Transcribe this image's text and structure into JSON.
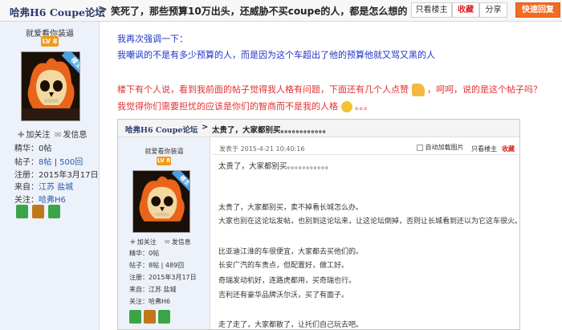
{
  "header": {
    "forum": "哈弗H6 Coupe论坛",
    "arrow": ">",
    "thread_title": "笑死了，那些预算10万出头，还威胁不买coupe的人，都是怎么想的",
    "btn_only_op": "只看楼主",
    "btn_fav": "收藏",
    "btn_share": "分享",
    "btn_reply": "快速回复"
  },
  "sidebar": {
    "username": "就爱看你装逼",
    "level": "LV 8",
    "ribbon": "楼主",
    "follow": "加关注",
    "message": "发信息",
    "jinghua_label": "精华：",
    "jinghua_value": "0帖",
    "posts_label": "帖子：",
    "posts_value": "8帖",
    "posts_sep": "|",
    "replies_value": "500回",
    "reg_label": "注册：",
    "reg_value": "2015年3月17日",
    "from_label": "来自：",
    "from_value": "江苏  盐城",
    "follow_label": "关注：",
    "follow_value": "哈弗H6"
  },
  "post": {
    "line0": "我再次强调一下：",
    "line1": "我嘲讽的不是有多少预算的人，而是因为这个车超出了他的预算他就又骂又黑的人",
    "line2a": "楼下有个人说，看到我前面的帖子觉得我人格有问题，下面还有几个人点赞",
    "line2b": "，呵呵，说的是这个帖子吗？",
    "line3": "我觉得你们需要担忧的应该是你们的智商而不是我的人格",
    "line3_dots": "。。。"
  },
  "quote": {
    "forum": "哈弗H6 Coupe论坛",
    "arrow": ">",
    "title": "太贵了，大家都别买。。。。。。。。。。。。",
    "username": "就爱看你装逼",
    "level": "LV 8",
    "ribbon": "楼主",
    "follow": "加关注",
    "message": "发信息",
    "jinghua": "精华：0帖",
    "posts": "帖子：8帖  |  489回",
    "reg": "注册：2015年3月17日",
    "from": "来自：江苏  盐城",
    "follow_field": "关注：哈弗H6",
    "posted_at": "发表于 2015-4-21 10:40:16",
    "autoload": "自动加载图片",
    "only_op": "只看楼主",
    "fav": "收藏",
    "body_title": "太贵了，大家都别买。。。。。。。。。。。",
    "lines": [
      "太贵了，大家都别买，卖不掉看长城怎么办。",
      "大家也别在这论坛发帖，也别到这论坛来，让这论坛倒掉，否则让长城看到还以为它这车很火。",
      "比亚迪江淮的车很便宜，大家都去买他们的。",
      "长安广汽的车贵点，但配置好，做工好。",
      "奇瑞发动机好，连路虎都用，买奇瑞也行。",
      "吉利还有豪华品牌沃尔沃，买了有面子。",
      "走了走了，大家都散了，让托们自己玩去吧。"
    ]
  }
}
